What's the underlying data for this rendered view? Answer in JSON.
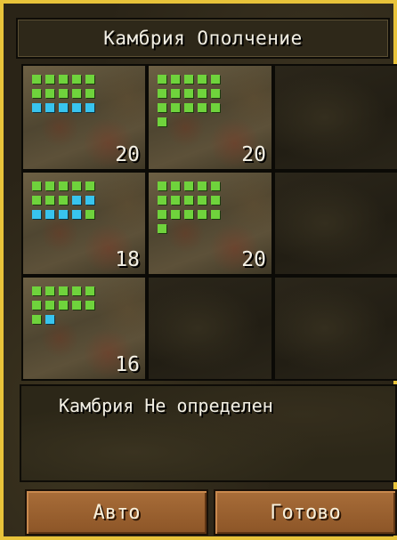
{
  "title": "Камбрия Ополчение",
  "slots": [
    {
      "filled": true,
      "count": "20",
      "dots": "ggggggggggbbbbb"
    },
    {
      "filled": true,
      "count": "20",
      "dots": "gggggggggggggggg"
    },
    {
      "filled": false
    },
    {
      "filled": true,
      "count": "18",
      "dots": "ggggggggbbbbbbg"
    },
    {
      "filled": true,
      "count": "20",
      "dots": "gggggggggggggggg"
    },
    {
      "filled": false
    },
    {
      "filled": true,
      "count": "16",
      "dots": "gggggggggggb"
    },
    {
      "filled": false
    },
    {
      "filled": false
    }
  ],
  "info": {
    "text": "Камбрия Не определен"
  },
  "buttons": {
    "auto": "Авто",
    "done": "Готово"
  },
  "colors": {
    "frame": "#e8c33a",
    "unit_green": "#6fd33c",
    "unit_blue": "#38c4ee",
    "button": "#a86d39"
  }
}
